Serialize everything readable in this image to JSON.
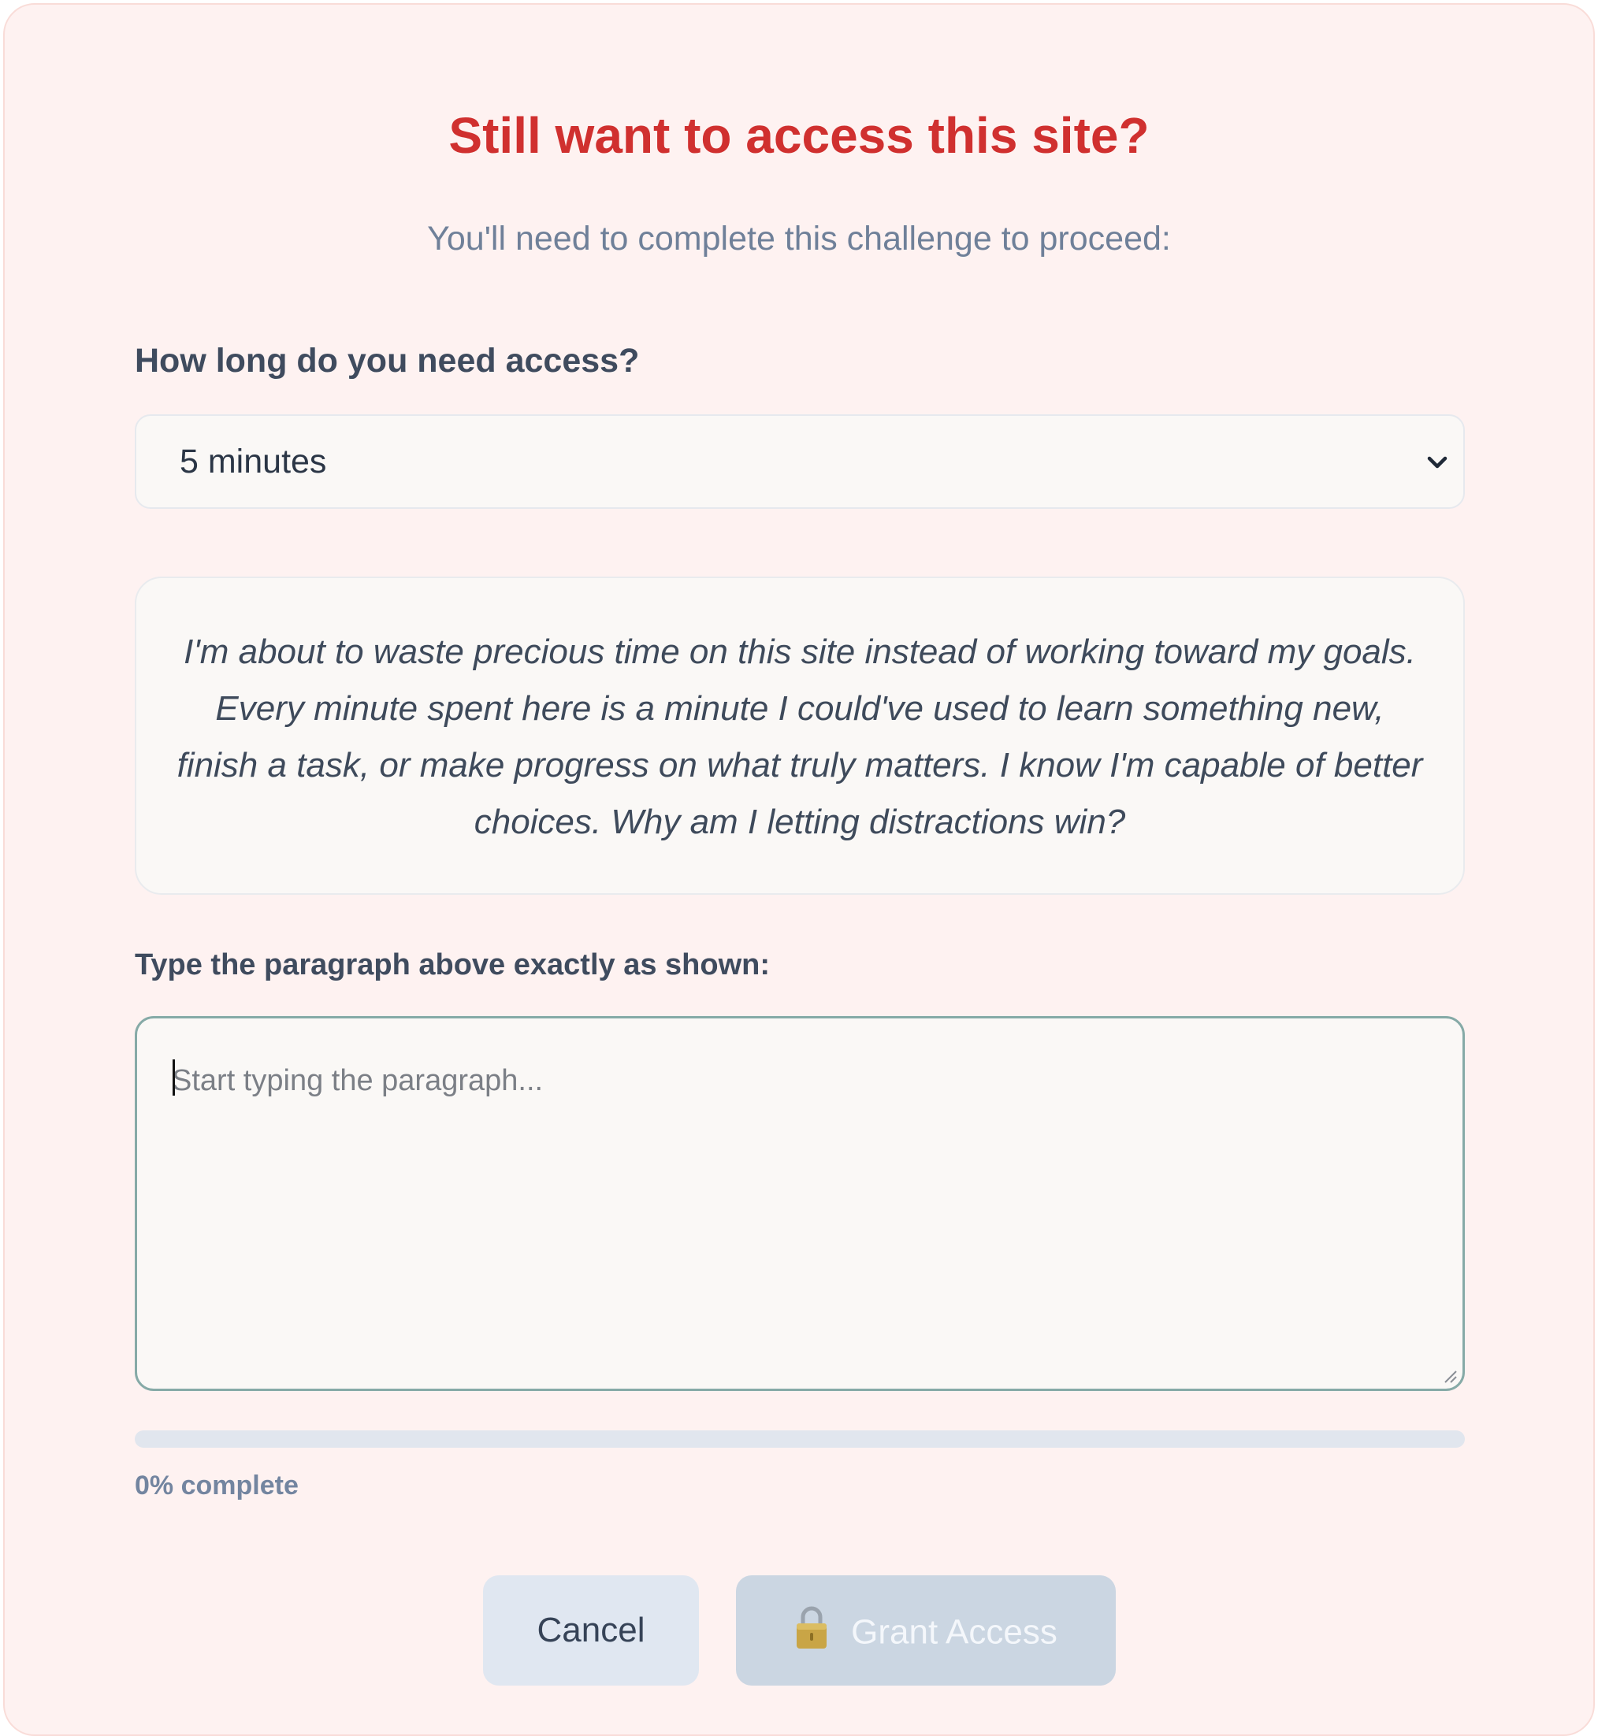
{
  "dialog": {
    "title": "Still want to access this site?",
    "subtitle": "You'll need to complete this challenge to proceed:"
  },
  "duration": {
    "label": "How long do you need access?",
    "selected": "5 minutes",
    "icon": "chevron-down-icon"
  },
  "challenge": {
    "paragraph": "I'm about to waste precious time on this site instead of working toward my goals. Every minute spent here is a minute I could've used to learn something new, finish a task, or make progress on what truly matters. I know I'm capable of better choices. Why am I letting distractions win?",
    "input_label": "Type the paragraph above exactly as shown:",
    "input_value": "",
    "input_placeholder": "Start typing the paragraph..."
  },
  "progress": {
    "percent": 0,
    "text": "0% complete"
  },
  "actions": {
    "cancel_label": "Cancel",
    "grant_label": "Grant Access",
    "grant_icon": "lock-icon",
    "grant_enabled": false
  },
  "colors": {
    "title": "#d0302f",
    "background": "#fef2f1",
    "accent_border": "#86aaa7"
  }
}
